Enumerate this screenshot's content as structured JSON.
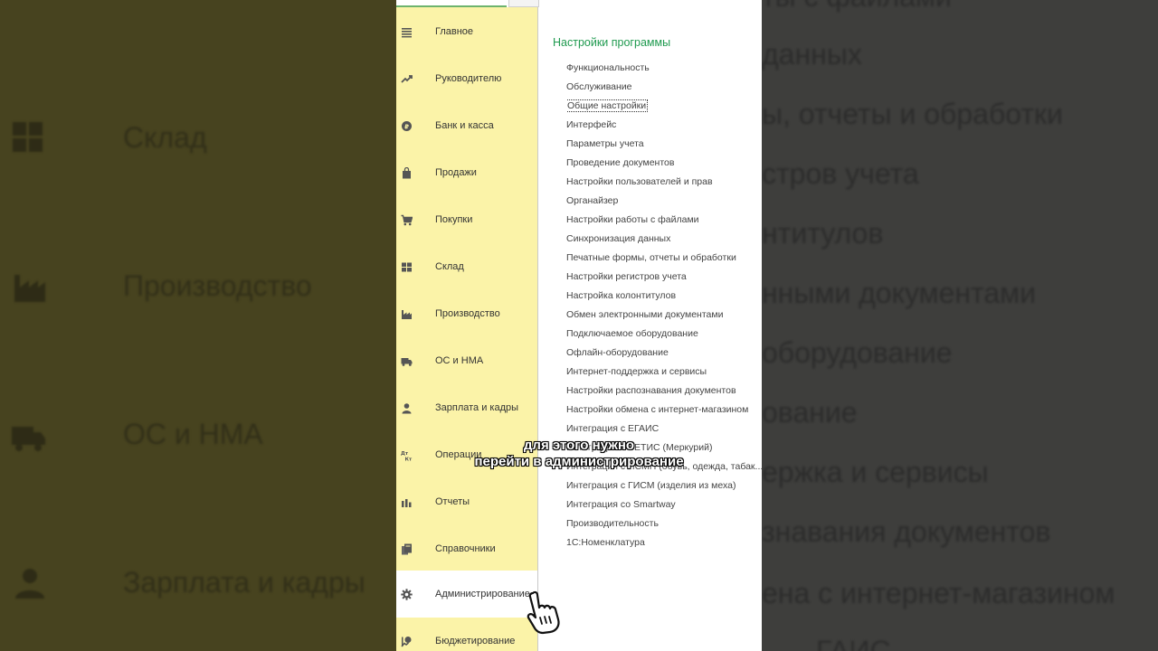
{
  "background_left": {
    "rows": [
      "Склад",
      "Производство",
      "ОС и НМА",
      "Зарплата и кадры"
    ]
  },
  "background_right": {
    "rows": [
      "ты с файлами",
      "данных",
      "ы, отчеты и обработки",
      "стров учета",
      "нтитулов",
      "нными документами",
      "оборудование",
      "ование",
      "ержка и сервисы",
      "знавания документов",
      "ена с интернет-магазином",
      "ГАИС"
    ]
  },
  "sidebar": {
    "items": [
      {
        "label": "Главное",
        "icon": "menu-lines-icon"
      },
      {
        "label": "Руководителю",
        "icon": "trend-up-icon"
      },
      {
        "label": "Банк и касса",
        "icon": "coin-icon"
      },
      {
        "label": "Продажи",
        "icon": "shopping-bag-icon"
      },
      {
        "label": "Покупки",
        "icon": "shopping-cart-icon"
      },
      {
        "label": "Склад",
        "icon": "warehouse-grid-icon"
      },
      {
        "label": "Производство",
        "icon": "factory-icon"
      },
      {
        "label": "ОС и НМА",
        "icon": "truck-icon"
      },
      {
        "label": "Зарплата и кадры",
        "icon": "person-icon"
      },
      {
        "label": "Операции",
        "icon": "debit-credit-icon"
      },
      {
        "label": "Отчеты",
        "icon": "bar-chart-icon"
      },
      {
        "label": "Справочники",
        "icon": "books-icon"
      },
      {
        "label": "Администрирование",
        "icon": "gear-icon"
      },
      {
        "label": "Бюджетирование",
        "icon": "budget-icon"
      }
    ],
    "active": "Администрирование"
  },
  "content": {
    "section_title": "Настройки программы",
    "links": [
      "Функциональность",
      "Обслуживание",
      "Общие настройки",
      "Интерфейс",
      "Параметры учета",
      "Проведение документов",
      "Настройки пользователей и прав",
      "Органайзер",
      "Настройки работы с файлами",
      "Синхронизация данных",
      "Печатные формы, отчеты и обработки",
      "Настройки регистров учета",
      "Настройка колонтитулов",
      "Обмен электронными документами",
      "Подключаемое оборудование",
      "Офлайн-оборудование",
      "Интернет-поддержка и сервисы",
      "Настройки распознавания документов",
      "Настройки обмена с интернет-магазином",
      "Интеграция с ЕГАИС",
      "Интеграция с ВЕТИС (Меркурий)",
      "Интеграция с ИСМП (обувь, одежда, табак...)",
      "Интеграция с ГИСМ (изделия из меха)",
      "Интеграция со Smartway",
      "Производительность",
      "1С:Номенклатура"
    ],
    "focused": "Общие настройки"
  },
  "caption": {
    "line1": "для этого нужно",
    "line2": "перейти в администрирование"
  },
  "colors": {
    "sidebar_bg": "#fbf3a8",
    "section_title": "#1f9a4f",
    "link_text": "#444444"
  }
}
